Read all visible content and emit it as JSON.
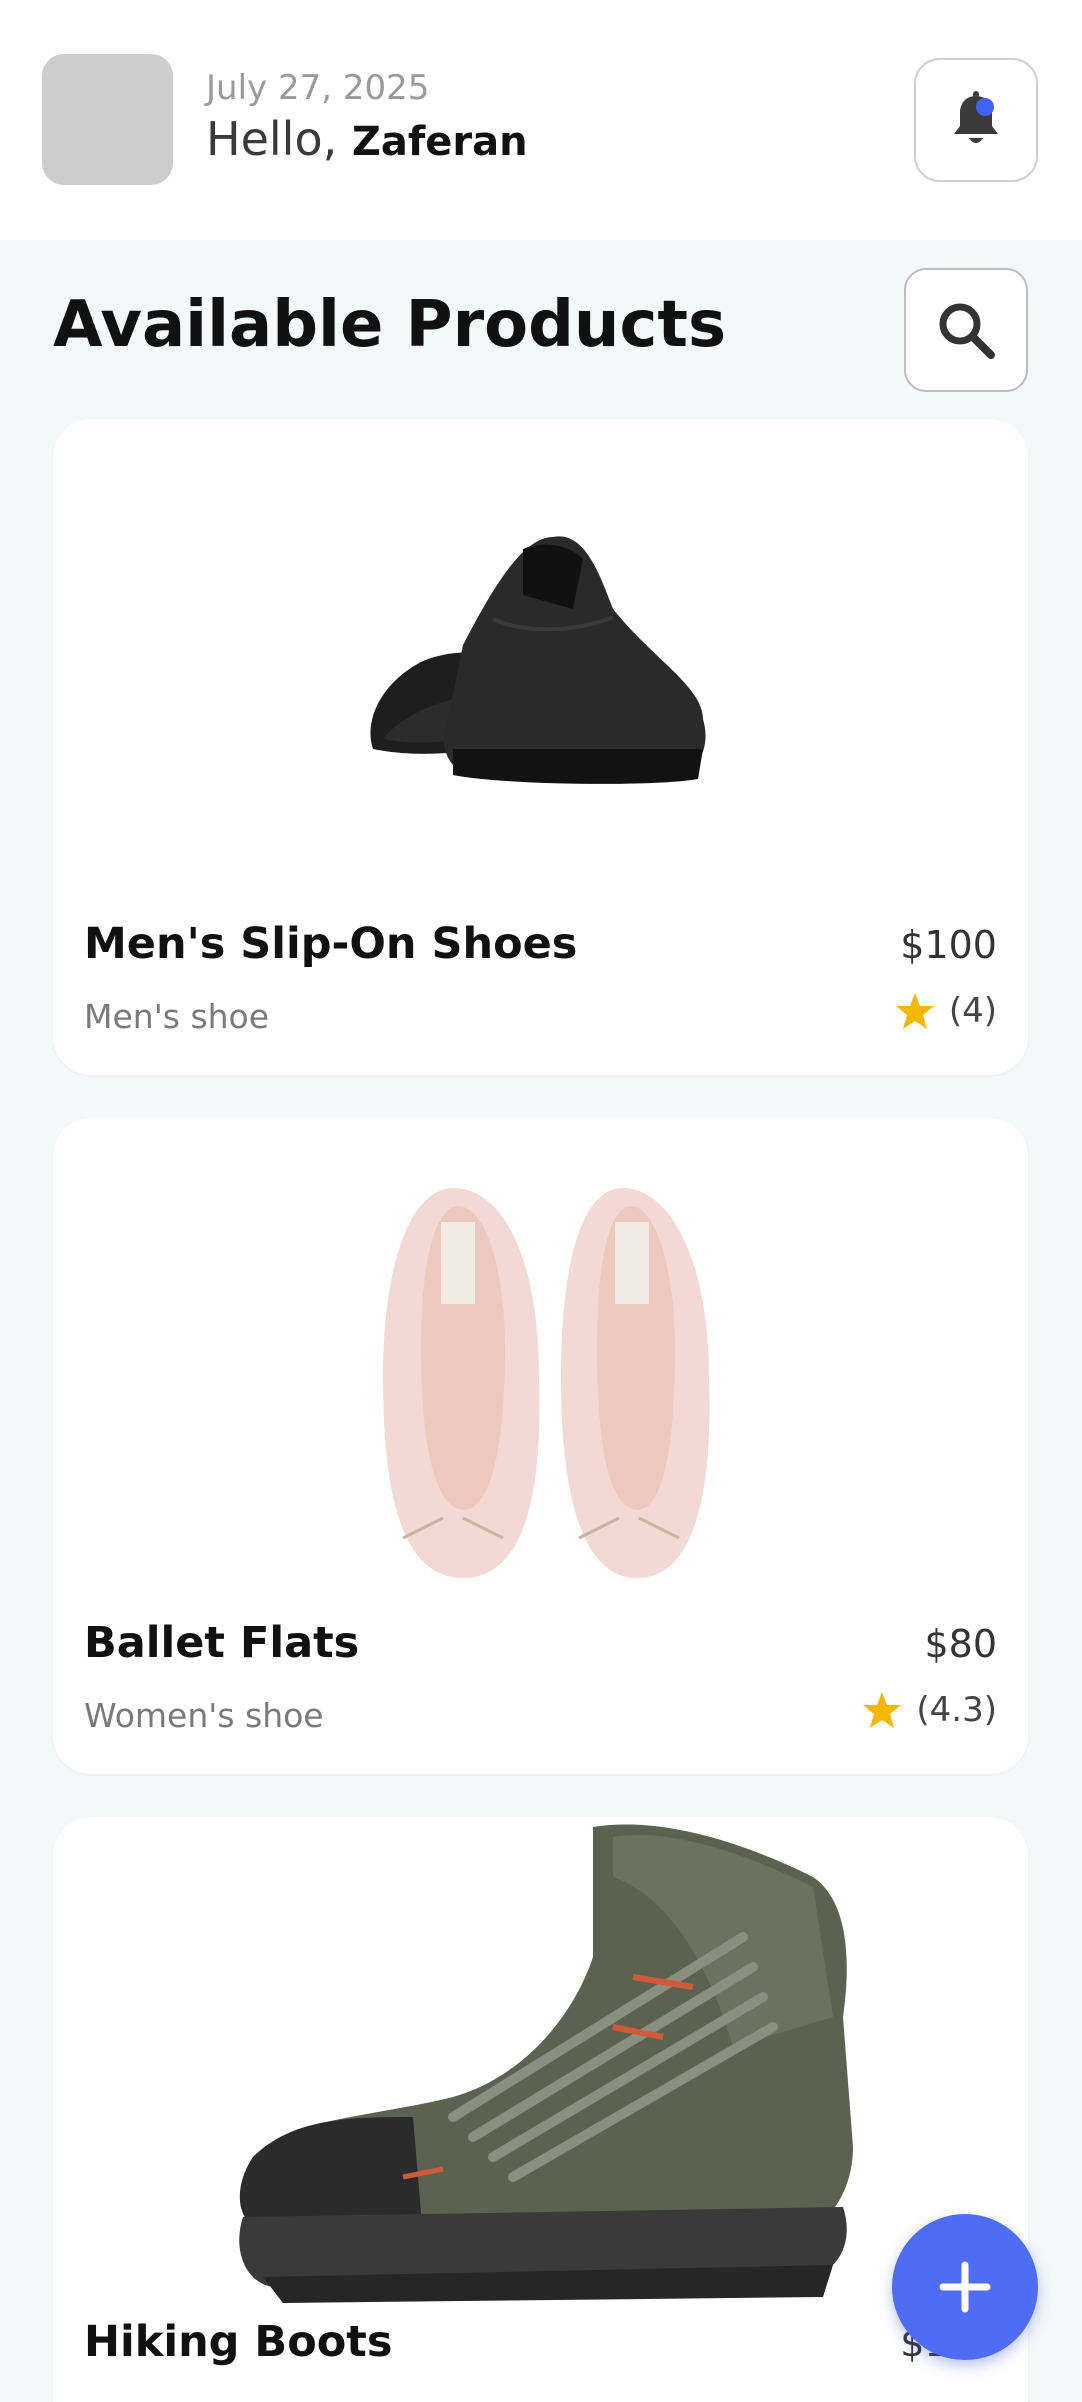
{
  "header": {
    "date": "July 27, 2025",
    "greeting": "Hello,",
    "user_name": "Zaferan",
    "avatar_icon": "avatar-placeholder",
    "notification_icon": "bell-icon",
    "notification_dot_color": "#3f63f5"
  },
  "main": {
    "title": "Available Products",
    "search_icon": "search-icon"
  },
  "products": [
    {
      "name": "Men's Slip-On Shoes",
      "price": "$100",
      "category": "Men's shoe",
      "rating": "(4)",
      "image": "black-slip-on-shoes"
    },
    {
      "name": "Ballet Flats",
      "price": "$80",
      "category": "Women's shoe",
      "rating": "(4.3)",
      "image": "pink-ballet-flats"
    },
    {
      "name": "Hiking Boots",
      "price": "$150",
      "category": "",
      "rating": "",
      "image": "green-hiking-boot"
    }
  ],
  "fab": {
    "icon": "plus-icon",
    "color": "#4f6cf5"
  },
  "colors": {
    "accent": "#4f6cf5",
    "star": "#f5b800",
    "background": "#f3f8f8"
  }
}
